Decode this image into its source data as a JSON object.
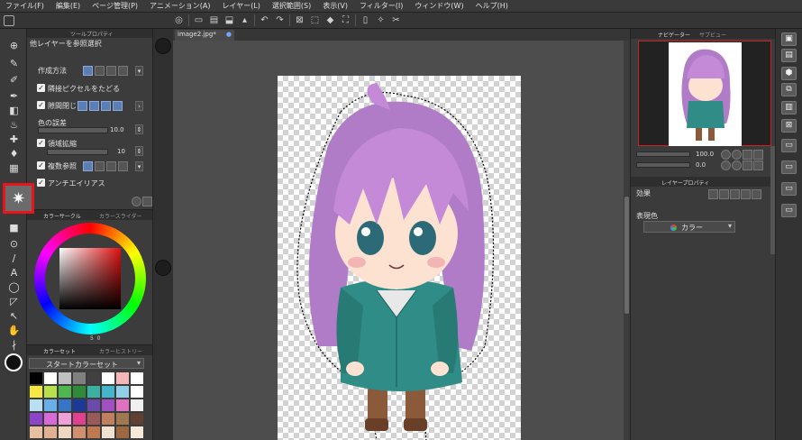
{
  "menu": [
    "ファイル(F)",
    "編集(E)",
    "ページ管理(P)",
    "アニメーション(A)",
    "レイヤー(L)",
    "選択範囲(S)",
    "表示(V)",
    "フィルター(I)",
    "ウィンドウ(W)",
    "ヘルプ(H)"
  ],
  "tool_property": {
    "tab_label": "ツールプロパティ",
    "title": "他レイヤーを参照選択",
    "method_label": "作成方法",
    "follow_adjacent_label": "隣接ピクセルをたどる",
    "close_gaps_label": "隙間閉じ",
    "color_margin_label": "色の誤差",
    "color_margin_value": "10.0",
    "area_scaling_label": "領域拡縮",
    "area_scaling_value": "10",
    "multi_ref_label": "複数参照",
    "antialias_label": "アンチエイリアス"
  },
  "color_circle": {
    "tab_label": "カラーサークル",
    "tab2_label": "カラースライダー",
    "value_s": "5",
    "value_v": "0"
  },
  "color_set": {
    "tab_label": "カラーセット",
    "tab2_label": "カラーヒストリー",
    "selected": "スタートカラーセット",
    "swatches": [
      "#000000",
      "#ffffff",
      "#c0c0c0",
      "#808080",
      "#404040",
      "#ffffff",
      "#f4b6b6",
      "#ffffff",
      "#f5e642",
      "#b8e04a",
      "#4fb54f",
      "#2e8b3a",
      "#3ab0a0",
      "#43b7c9",
      "#8fd0e8",
      "#ffffff",
      "#b8e0f0",
      "#6ab0e8",
      "#3874c8",
      "#1a3a9a",
      "#6a4aa8",
      "#a050c0",
      "#e070c0",
      "#f0f0f0",
      "#8e44c8",
      "#d86ad8",
      "#f0a0d8",
      "#e04090",
      "#9a5a5a",
      "#c08060",
      "#a07850",
      "#604030",
      "#e8c0a0",
      "#e0b090",
      "#f0d8c0",
      "#d09070",
      "#c07850",
      "#f0e0d0",
      "#a06840",
      "#f8e8d8"
    ]
  },
  "document": {
    "tab_label": "image2.jpg*"
  },
  "navigator": {
    "tab_label": "ナビゲーター",
    "tab2_label": "サブビュー",
    "zoom": "100.0",
    "rotate": "0.0"
  },
  "layer_property": {
    "tab_label": "レイヤープロパティ",
    "effect_label": "効果",
    "expression_label": "表現色",
    "expression_value": "カラー"
  }
}
